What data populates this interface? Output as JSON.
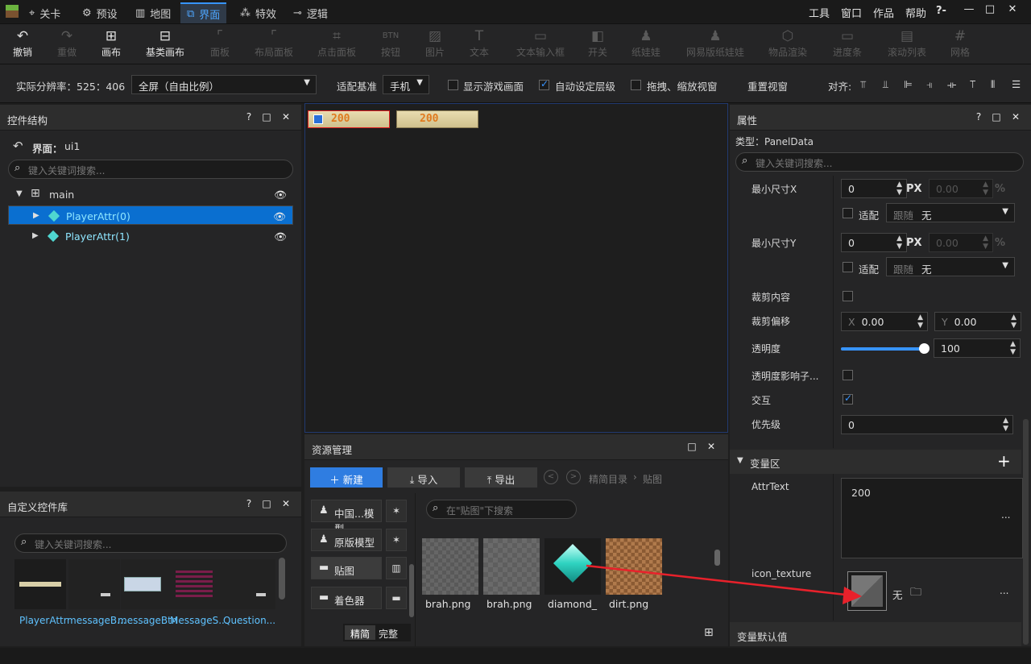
{
  "topbar": {
    "tabs": [
      {
        "label": "关卡",
        "icon": "crosshair-icon"
      },
      {
        "label": "预设",
        "icon": "gear-icon"
      },
      {
        "label": "地图",
        "icon": "map-icon"
      },
      {
        "label": "界面",
        "icon": "ui-icon"
      },
      {
        "label": "特效",
        "icon": "effect-icon"
      },
      {
        "label": "逻辑",
        "icon": "logic-icon"
      }
    ],
    "right_menu": [
      "工具",
      "窗口",
      "作品",
      "帮助"
    ],
    "help_icon": "?-",
    "accent": "#3794ff"
  },
  "toolbar": {
    "tools": [
      {
        "label": "撤销",
        "icon": "undo-icon",
        "enabled": true
      },
      {
        "label": "重做",
        "icon": "redo-icon",
        "enabled": false
      },
      {
        "label": "画布",
        "icon": "canvas-icon",
        "enabled": true
      },
      {
        "label": "基类画布",
        "icon": "base-canvas-icon",
        "enabled": true
      },
      {
        "label": "面板",
        "icon": "panel-icon",
        "enabled": false
      },
      {
        "label": "布局面板",
        "icon": "layout-panel-icon",
        "enabled": false
      },
      {
        "label": "点击面板",
        "icon": "click-panel-icon",
        "enabled": false
      },
      {
        "label": "按钮",
        "icon": "button-icon",
        "enabled": false
      },
      {
        "label": "图片",
        "icon": "image-icon",
        "enabled": false
      },
      {
        "label": "文本",
        "icon": "text-icon",
        "enabled": false
      },
      {
        "label": "文本输入框",
        "icon": "text-input-icon",
        "enabled": false
      },
      {
        "label": "开关",
        "icon": "switch-icon",
        "enabled": false
      },
      {
        "label": "纸娃娃",
        "icon": "doll-icon",
        "enabled": false
      },
      {
        "label": "网易版纸娃娃",
        "icon": "netease-doll-icon",
        "enabled": false
      },
      {
        "label": "物品渲染",
        "icon": "item-render-icon",
        "enabled": false
      },
      {
        "label": "进度条",
        "icon": "progress-icon",
        "enabled": false
      },
      {
        "label": "滚动列表",
        "icon": "scroll-list-icon",
        "enabled": false
      },
      {
        "label": "网格",
        "icon": "grid-icon",
        "enabled": false
      }
    ]
  },
  "options": {
    "resolution_label": "实际分辨率：525：406",
    "screen_select": "全屏（自由比例）",
    "adapt_label": "适配基准",
    "adapt_select": "手机",
    "show_game": "显示游戏画面",
    "auto_level": "自动设定层级",
    "drag_zoom": "拖拽、缩放视窗",
    "reset_view": "重置视窗",
    "align_label": "对齐:"
  },
  "structure_panel": {
    "title": "控件结构",
    "back_label": "界面：",
    "ui_name": "ui1",
    "search_placeholder": "键入关键词搜索...",
    "root": "main",
    "children": [
      "PlayerAttr(0)",
      "PlayerAttr(1)"
    ]
  },
  "custom_lib": {
    "title": "自定义控件库",
    "search_placeholder": "键入关键词搜索...",
    "items": [
      "PlayerAttr",
      "messageB...",
      "messageBtn",
      "MessageS...",
      "Question..."
    ]
  },
  "canvas": {
    "bars": [
      "200",
      "200"
    ]
  },
  "resources": {
    "title": "资源管理",
    "new_btn": "新建",
    "import_btn": "导入",
    "export_btn": "导出",
    "breadcrumb_root": "精简目录",
    "breadcrumb_current": "贴图",
    "search_placeholder": "在\"贴图\"下搜索",
    "categories": [
      "中国...模型",
      "原版模型",
      "贴图",
      "着色器"
    ],
    "mode_simple": "精简",
    "mode_full": "完整",
    "textures": [
      "brah.png",
      "brah.png",
      "diamond_",
      "dirt.png"
    ]
  },
  "properties": {
    "title": "属性",
    "type_label": "类型：PanelData",
    "search_placeholder": "键入关键词搜索...",
    "min_x_label": "最小尺寸X",
    "min_x_value": "0",
    "min_x_percent": "0.00",
    "min_y_label": "最小尺寸Y",
    "min_y_value": "0",
    "min_y_percent": "0.00",
    "px": "PX",
    "pct": "%",
    "fit_label": "适配",
    "follow_label": "跟随",
    "follow_value": "无",
    "clip_label": "裁剪内容",
    "clip_offset_label": "裁剪偏移",
    "x_prefix": "X",
    "y_prefix": "Y",
    "clip_x": "0.00",
    "clip_y": "0.00",
    "alpha_label": "透明度",
    "alpha_value": "100",
    "alpha_fraction": 1.0,
    "alpha_child_label": "透明度影响子...",
    "interact_label": "交互",
    "priority_label": "优先级",
    "priority_value": "0",
    "var_section": "变量区",
    "attr_text_label": "AttrText",
    "attr_text_value": "200",
    "icon_texture_label": "icon_texture",
    "icon_texture_value": "无",
    "more": "...",
    "default_section": "变量默认值"
  }
}
